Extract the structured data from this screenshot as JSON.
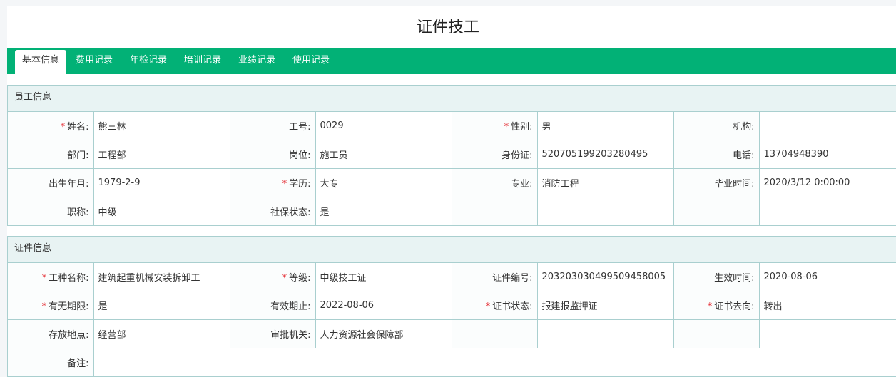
{
  "page": {
    "title": "证件技工"
  },
  "tabs": [
    "基本信息",
    "费用记录",
    "年检记录",
    "培训记录",
    "业绩记录",
    "使用记录"
  ],
  "employee": {
    "header": "员工信息",
    "rows": [
      [
        {
          "label": "姓名:",
          "value": "熊三林",
          "required": true
        },
        {
          "label": "工号:",
          "value": "0029"
        },
        {
          "label": "性别:",
          "value": "男",
          "required": true
        },
        {
          "label": "机构:",
          "value": ""
        }
      ],
      [
        {
          "label": "部门:",
          "value": "工程部"
        },
        {
          "label": "岗位:",
          "value": "施工员"
        },
        {
          "label": "身份证:",
          "value": "520705199203280495"
        },
        {
          "label": "电话:",
          "value": "13704948390"
        }
      ],
      [
        {
          "label": "出生年月:",
          "value": "1979-2-9"
        },
        {
          "label": "学历:",
          "value": "大专",
          "required": true
        },
        {
          "label": "专业:",
          "value": "消防工程"
        },
        {
          "label": "毕业时间:",
          "value": "2020/3/12 0:00:00"
        }
      ],
      [
        {
          "label": "职称:",
          "value": "中级"
        },
        {
          "label": "社保状态:",
          "value": "是"
        },
        {
          "label": "",
          "value": ""
        },
        {
          "label": "",
          "value": ""
        }
      ]
    ]
  },
  "certificate": {
    "header": "证件信息",
    "rows": [
      [
        {
          "label": "工种名称:",
          "value": "建筑起重机械安装拆卸工",
          "required": true
        },
        {
          "label": "等级:",
          "value": "中级技工证",
          "required": true
        },
        {
          "label": "证件编号:",
          "value": "203203030499509458005"
        },
        {
          "label": "生效时间:",
          "value": "2020-08-06"
        }
      ],
      [
        {
          "label": "有无期限:",
          "value": "是",
          "required": true
        },
        {
          "label": "有效期止:",
          "value": "2022-08-06"
        },
        {
          "label": "证书状态:",
          "value": "报建报监押证",
          "required": true
        },
        {
          "label": "证书去向:",
          "value": "转出",
          "required": true
        }
      ],
      [
        {
          "label": "存放地点:",
          "value": "经营部"
        },
        {
          "label": "审批机关:",
          "value": "人力资源社会保障部"
        },
        {
          "label": "",
          "value": ""
        },
        {
          "label": "",
          "value": ""
        }
      ]
    ],
    "remark": {
      "label": "备注:",
      "value": ""
    }
  },
  "colors": {
    "accent": "#02b176",
    "border": "#a9cfcf",
    "panel_header": "#e8f3f3",
    "required": "#e4262d"
  }
}
